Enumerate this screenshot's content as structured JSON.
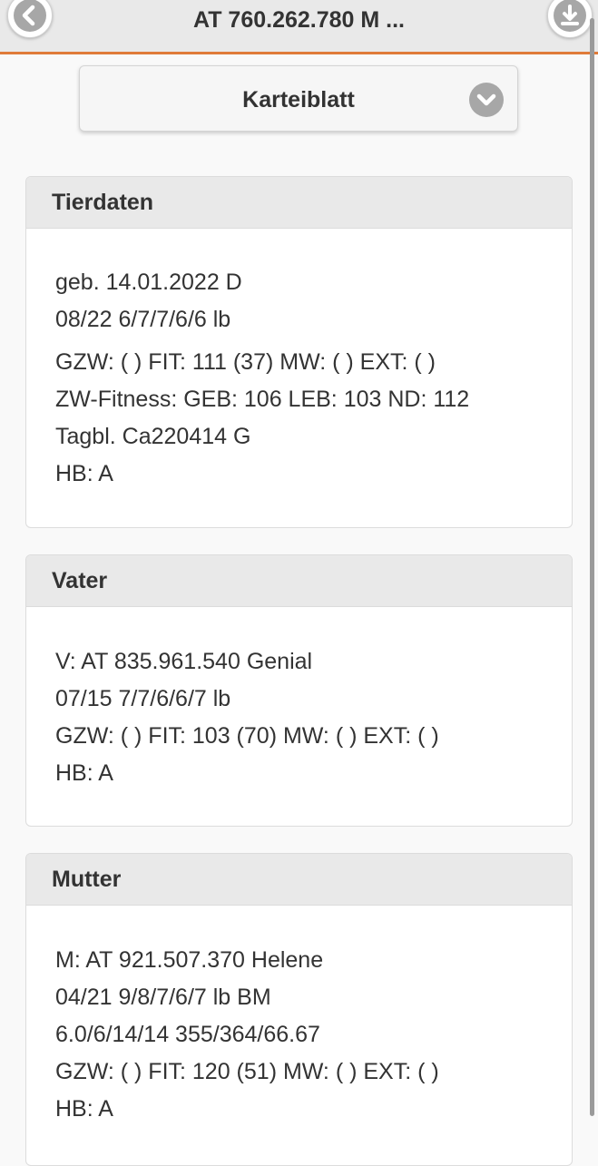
{
  "header": {
    "title": "AT 760.262.780 M ..."
  },
  "icons": {
    "back": "arrow-left-icon",
    "download": "download-icon",
    "select": "chevron-down-icon"
  },
  "colors": {
    "accent": "#e07b39",
    "icon_bg": "#a7a7a7"
  },
  "view_select": {
    "selected": "Karteiblatt"
  },
  "sections": {
    "tierdaten": {
      "title": "Tierdaten",
      "lines": [
        "geb. 14.01.2022 D",
        "08/22 6/7/7/6/6 lb",
        "GZW: ( ) FIT: 111 (37) MW: ( ) EXT: ( )",
        "ZW-Fitness: GEB: 106 LEB: 103 ND: 112",
        "Tagbl. Ca220414 G",
        "HB: A"
      ]
    },
    "vater": {
      "title": "Vater",
      "lines": [
        "V: AT 835.961.540 Genial",
        "07/15 7/7/6/6/7 lb",
        "GZW: ( ) FIT: 103 (70) MW: ( ) EXT: ( )",
        "HB: A"
      ]
    },
    "mutter": {
      "title": "Mutter",
      "lines": [
        "M: AT 921.507.370 Helene",
        "04/21 9/8/7/6/7 lb BM",
        "6.0/6/14/14 355/364/66.67",
        "GZW: ( ) FIT: 120 (51) MW: ( ) EXT: ( )",
        "HB: A"
      ]
    }
  }
}
